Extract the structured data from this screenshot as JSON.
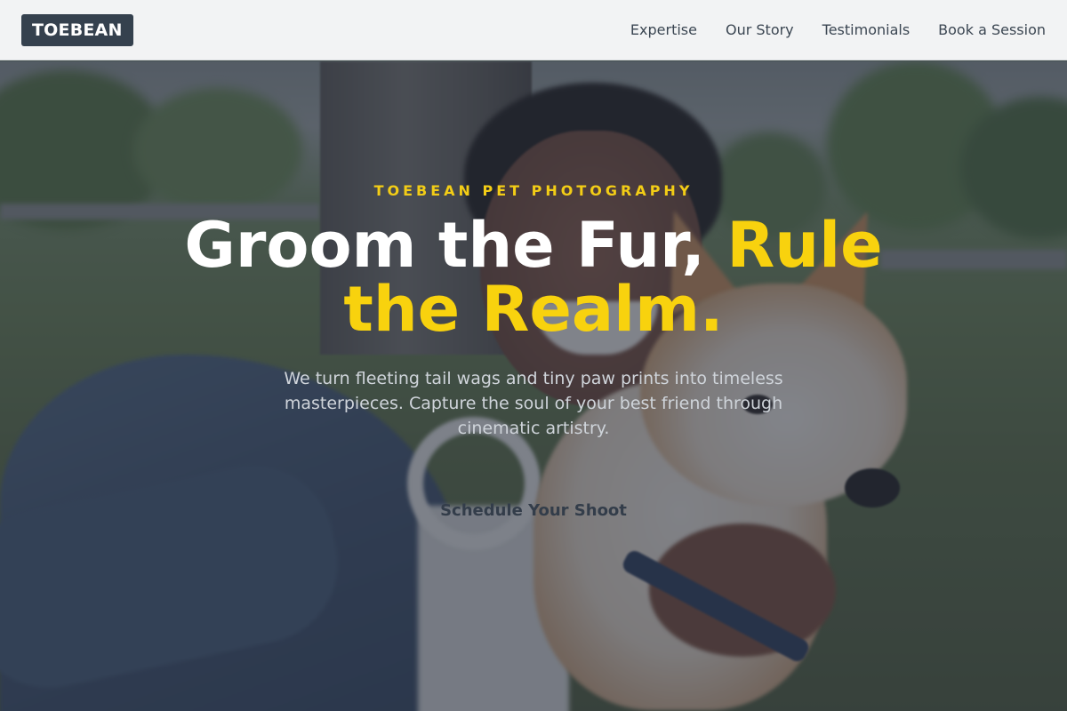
{
  "header": {
    "logo": "TOEBEAN",
    "nav": [
      "Expertise",
      "Our Story",
      "Testimonials",
      "Book a Session"
    ]
  },
  "hero": {
    "eyebrow": "TOEBEAN PET PHOTOGRAPHY",
    "headline_white": "Groom the Fur, ",
    "headline_accent": "Rule the Realm.",
    "subtext": "We turn fleeting tail wags and tiny paw prints into timeless masterpieces. Capture the soul of your best friend through cinematic artistry.",
    "cta": "Schedule Your Shoot"
  },
  "colors": {
    "accent": "#f8d20e",
    "logo_bg": "#35414e",
    "nav_text": "#3b4652"
  }
}
